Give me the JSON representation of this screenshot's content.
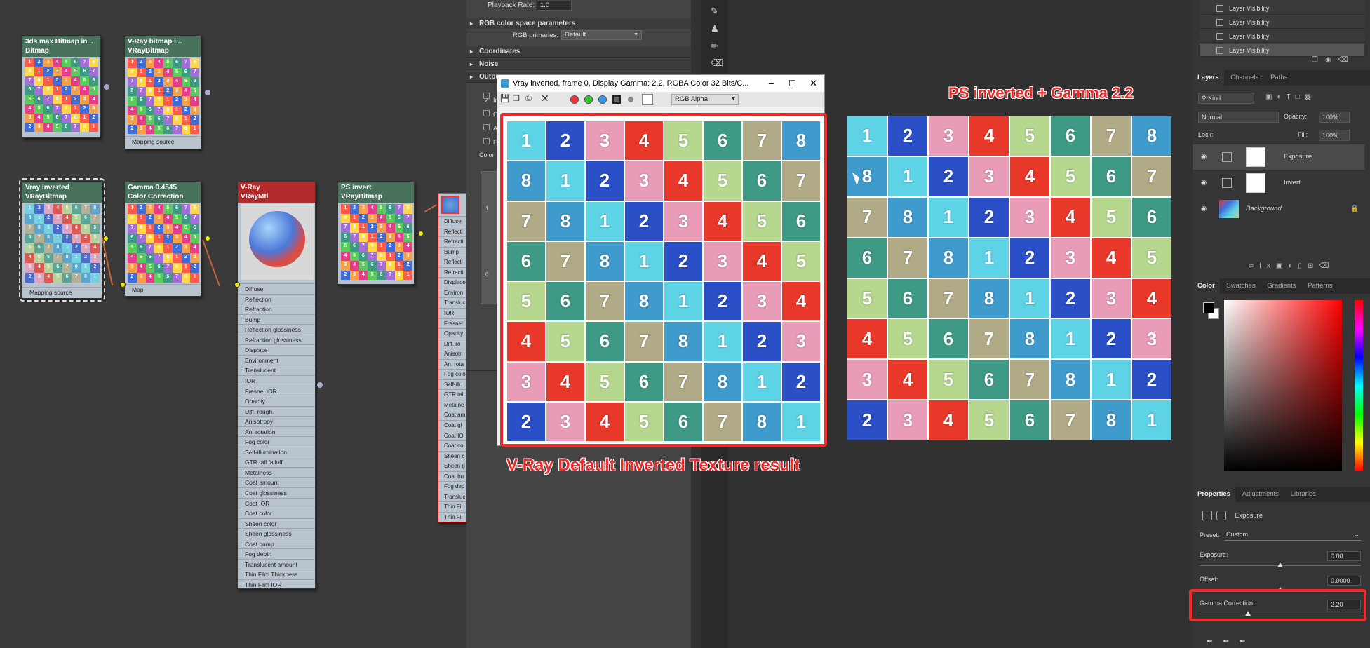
{
  "grid_rows": [
    [
      1,
      2,
      3,
      4,
      5,
      6,
      7,
      8
    ],
    [
      8,
      1,
      2,
      3,
      4,
      5,
      6,
      7
    ],
    [
      7,
      8,
      1,
      2,
      3,
      4,
      5,
      6
    ],
    [
      6,
      7,
      8,
      1,
      2,
      3,
      4,
      5
    ],
    [
      5,
      6,
      7,
      8,
      1,
      2,
      3,
      4
    ],
    [
      4,
      5,
      6,
      7,
      8,
      1,
      2,
      3
    ],
    [
      3,
      4,
      5,
      6,
      7,
      8,
      1,
      2
    ],
    [
      2,
      3,
      4,
      5,
      6,
      7,
      8,
      1
    ]
  ],
  "colors": {
    "1": "#5fd3e6",
    "2": "#2a4fc7",
    "3": "#e89cb8",
    "4": "#e8382a",
    "5": "#b6d88e",
    "6": "#3e9a84",
    "7": "#b0ab86",
    "8": "#3e9bcc",
    "thumb": [
      "#ff5a4a",
      "#3e6dd8",
      "#f4a04a",
      "#e63c8c",
      "#5acb5a",
      "#3e9a84",
      "#a46ed8",
      "#ffd84a"
    ],
    "highlight": "#ee2a2a"
  },
  "nodes": {
    "bitmap": {
      "title": "3ds max Bitmap in...",
      "subtitle": "Bitmap",
      "slot": "Mapping source"
    },
    "vray_bitmap": {
      "title": "V-Ray bitmap i...",
      "subtitle": "VRayBitmap",
      "slot": "Mapping source"
    },
    "vray_inverted": {
      "title": "Vray inverted",
      "subtitle": "VRayBitmap",
      "slot": "Mapping source"
    },
    "gamma": {
      "title": "Gamma 0.4545",
      "subtitle": "Color Correction",
      "slot": "Map"
    },
    "vraymtl": {
      "title": "V-Ray",
      "subtitle": "VRayMtl",
      "slots": [
        "Diffuse",
        "Reflection",
        "Refraction",
        "Bump",
        "Reflection glossiness",
        "Refraction glossiness",
        "Displace",
        "Environment",
        "Translucent",
        "IOR",
        "Fresnel IOR",
        "Opacity",
        "Diff. rough.",
        "Anisotropy",
        "An. rotation",
        "Fog color",
        "Self-illumination",
        "GTR tail falloff",
        "Metalness",
        "Coat amount",
        "Coat glossiness",
        "Coat IOR",
        "Coat color",
        "Sheen color",
        "Sheen glossiness",
        "Coat bump",
        "Fog depth",
        "Translucent amount",
        "Thin Film Thickness",
        "Thin Film IOR"
      ]
    },
    "ps_invert": {
      "title": "PS invert",
      "subtitle": "VRayBitmap"
    },
    "partial_slots": [
      "Diffuse",
      "Reflecti",
      "Refracti",
      "Bump",
      "Reflecti",
      "Refracti",
      "Displace",
      "Environ",
      "Transluc",
      "IOR",
      "Fresnel",
      "Opacity",
      "Diff. ro",
      "Anisotr",
      "An. rota",
      "Fog colo",
      "Self-illu",
      "GTR tail",
      "Metalne",
      "Coat am",
      "Coat gl",
      "Coat IO",
      "Coat co",
      "Sheen c",
      "Sheen g",
      "Coat bu",
      "Fog dep",
      "Transluc",
      "Thin Fil",
      "Thin Fil"
    ]
  },
  "max_panel": {
    "playback_label": "Playback Rate:",
    "playback_value": "1.0",
    "rollouts": [
      "RGB color space parameters",
      "Coordinates",
      "Noise",
      "Outpu"
    ],
    "rgb_primaries_label": "RGB primaries:",
    "rgb_primaries_value": "Default",
    "partial_labels": [
      "In",
      "C",
      "A",
      "E"
    ],
    "color_label": "Color",
    "axis_1": "1",
    "axis_0": "0"
  },
  "vfb": {
    "title": "Vray inverted, frame 0, Display Gamma: 2.2, RGBA Color 32 Bits/C...",
    "channel": "RGB Alpha"
  },
  "labels": {
    "vray_result": "V-Ray Default Inverted Texture result",
    "ps_result": "PS inverted + Gamma 2.2"
  },
  "ps": {
    "history": [
      "Layer Visibility",
      "Layer Visibility",
      "Layer Visibility",
      "Layer Visibility"
    ],
    "layer_tabs": [
      "Layers",
      "Channels",
      "Paths"
    ],
    "kind": "Kind",
    "blend_mode": "Normal",
    "opacity_label": "Opacity:",
    "opacity_value": "100%",
    "lock_label": "Lock:",
    "fill_label": "Fill:",
    "fill_value": "100%",
    "layers": [
      "Exposure",
      "Invert",
      "Background"
    ],
    "color_tabs": [
      "Color",
      "Swatches",
      "Gradients",
      "Patterns"
    ],
    "prop_tabs": [
      "Properties",
      "Adjustments",
      "Libraries"
    ],
    "prop_title": "Exposure",
    "preset_label": "Preset:",
    "preset_value": "Custom",
    "exposure_label": "Exposure:",
    "exposure_value": "0.00",
    "offset_label": "Offset:",
    "offset_value": "0.0000",
    "gamma_label": "Gamma Correction:",
    "gamma_value": "2.20",
    "exposure_level": 0.5,
    "offset_level": 0.5,
    "gamma_level": 0.3
  }
}
